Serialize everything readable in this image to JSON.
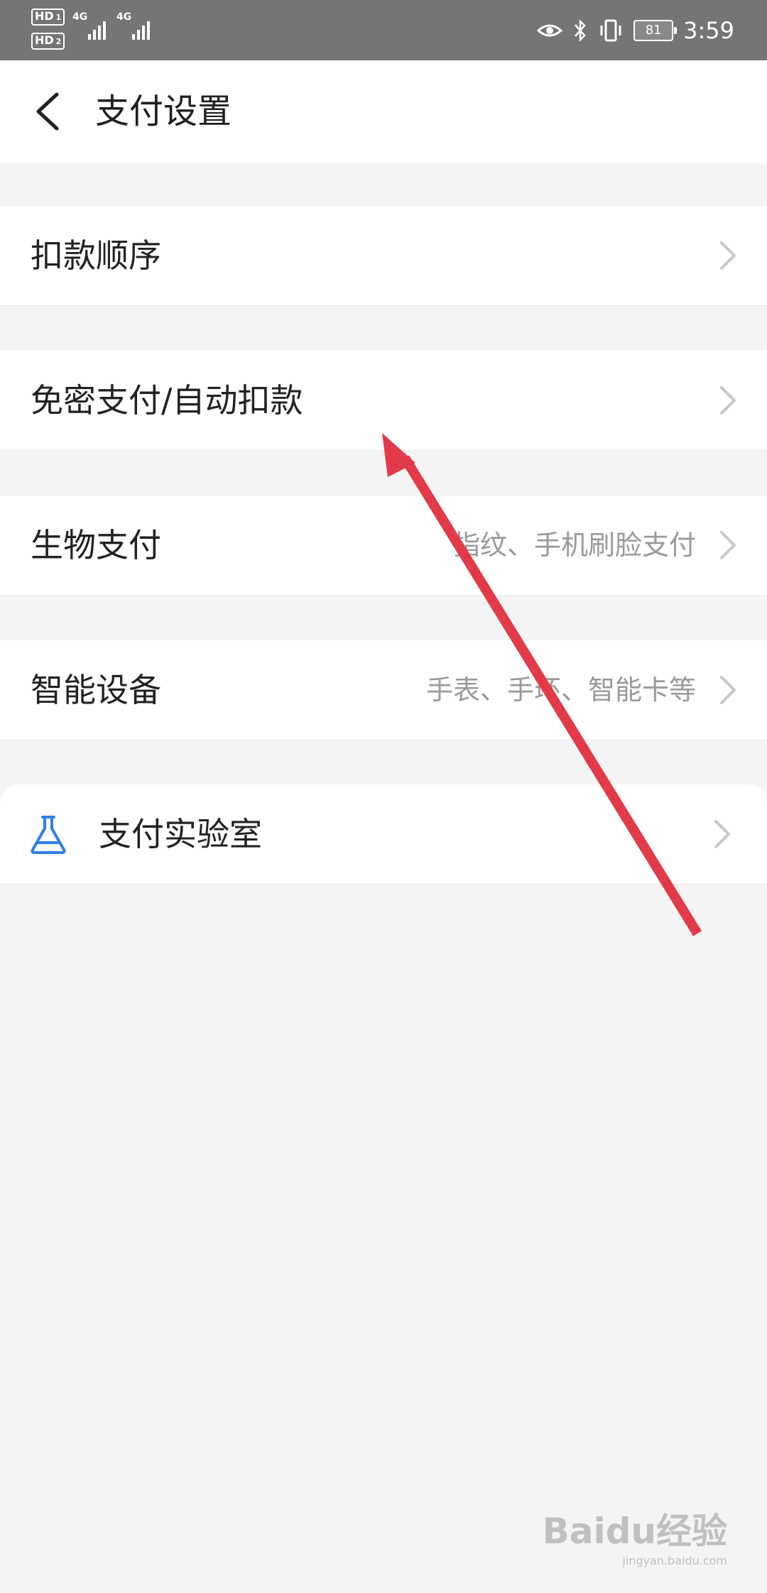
{
  "status_bar": {
    "hd1": "HD",
    "hd1_sub": "1",
    "hd2": "HD",
    "hd2_sub": "2",
    "net1": "4G",
    "net2": "4G",
    "battery": "81",
    "time": "3:59"
  },
  "header": {
    "title": "支付设置"
  },
  "rows": [
    {
      "label": "扣款顺序",
      "value": ""
    },
    {
      "label": "免密支付/自动扣款",
      "value": ""
    },
    {
      "label": "生物支付",
      "value": "指纹、手机刷脸支付"
    },
    {
      "label": "智能设备",
      "value": "手表、手环、智能卡等"
    }
  ],
  "lab": {
    "label": "支付实验室",
    "icon": "flask-icon"
  },
  "colors": {
    "accent_icon": "#2f7fe6",
    "annotation_arrow": "#e23a48",
    "background": "#f4f4f4"
  },
  "watermark": {
    "logo": "Baidu经验",
    "url": "jingyan.baidu.com"
  }
}
